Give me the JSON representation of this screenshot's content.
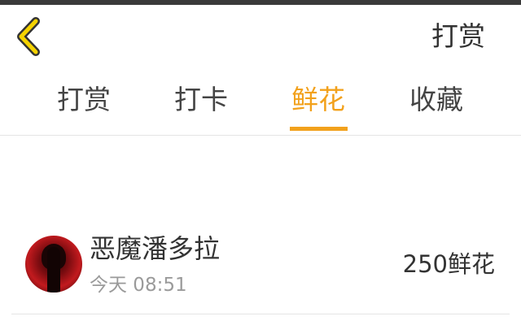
{
  "header": {
    "action_label": "打赏"
  },
  "tabs": [
    {
      "label": "打赏"
    },
    {
      "label": "打卡"
    },
    {
      "label": "鲜花"
    },
    {
      "label": "收藏"
    }
  ],
  "active_tab": "鲜花",
  "colors": {
    "accent": "#f2a11c",
    "back_icon": "#f5d300"
  },
  "records": [
    {
      "user_name": "恶魔潘多拉",
      "time": "今天 08:51",
      "amount": "250鲜花"
    }
  ]
}
